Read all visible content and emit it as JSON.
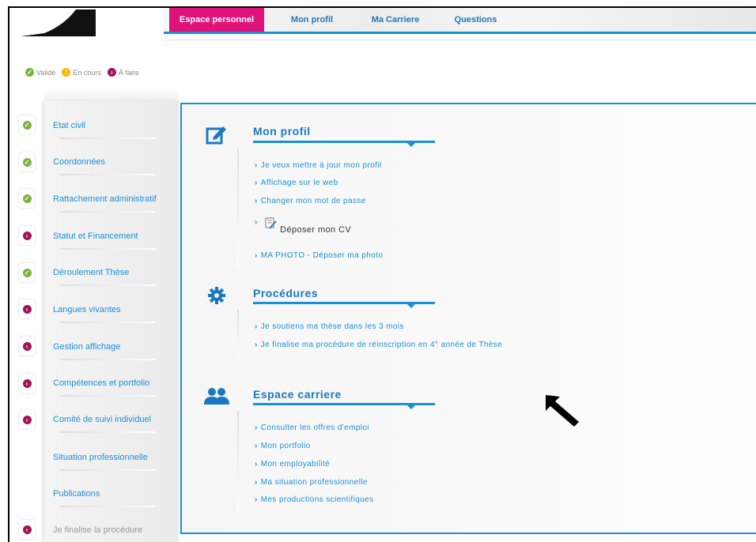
{
  "nav": {
    "items": [
      "Espace personnel",
      "Mon profil",
      "Ma Carriere",
      "Questions"
    ]
  },
  "legend": {
    "valide": "Validé",
    "en_cours": "En cours",
    "a_faire": "À faire"
  },
  "sidebar": {
    "items": [
      {
        "label": "Etat civil",
        "status": "valide"
      },
      {
        "label": "Coordonnées",
        "status": "valide"
      },
      {
        "label": "Rattachement administratif",
        "status": "valide"
      },
      {
        "label": "Statut et Financement",
        "status": "a_faire"
      },
      {
        "label": "Déroulement Thèse",
        "status": "valide"
      },
      {
        "label": "Langues vivantes",
        "status": "a_faire"
      },
      {
        "label": "Gestion affichage",
        "status": "a_faire"
      },
      {
        "label": "Compétences et portfolio",
        "status": "a_faire"
      },
      {
        "label": "Comité de suivi individuel",
        "status": "a_faire"
      },
      {
        "label": "Situation professionnelle",
        "status": ""
      },
      {
        "label": "Publications",
        "status": ""
      },
      {
        "label": "Je finalise la procédure",
        "status": "a_faire"
      }
    ]
  },
  "main": {
    "profil": {
      "title": "Mon profil",
      "links": [
        "Je veux mettre à jour mon profil",
        "Affichage sur le web",
        "Changer mon mot de passe",
        "Déposer mon CV",
        "MA PHOTO - Déposer ma photo"
      ]
    },
    "procedures": {
      "title": "Procédures",
      "links": [
        "Je soutiens ma thèse dans les 3 mois",
        "Je finalise ma procédure de réinscription en 4° année de Thèse"
      ]
    },
    "carriere": {
      "title": "Espace carriere",
      "links": [
        "Consulter les offres d'emploi",
        "Mon portfolio",
        "Mon employabilité",
        "Ma situation professionnelle",
        "Mes productions scientifiques"
      ]
    }
  },
  "colors": {
    "accent": "#1a90d8",
    "active_tab": "#e0127a",
    "valide": "#7cb342",
    "en_cours": "#f5b800",
    "a_faire": "#a3155a"
  },
  "icons": {
    "profil": "edit-icon",
    "procedures": "gear-icon",
    "carriere": "users-icon",
    "cv": "document-icon",
    "link": "chevron-right-icon",
    "pointer": "arrow-cursor-icon"
  }
}
